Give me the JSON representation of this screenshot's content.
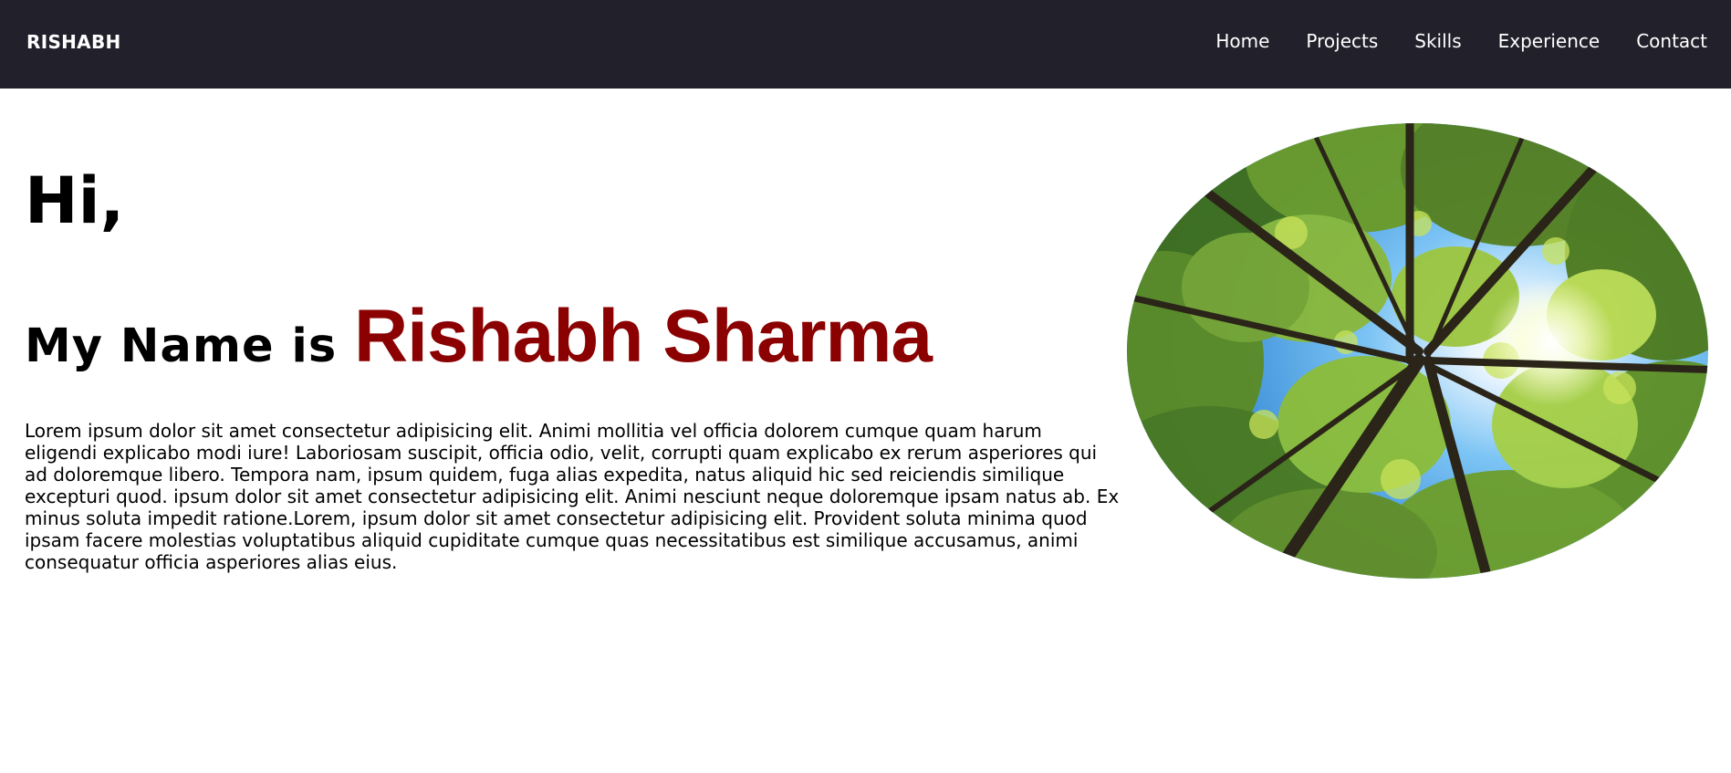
{
  "nav": {
    "brand": "RISHABH",
    "links": [
      "Home",
      "Projects",
      "Skills",
      "Experience",
      "Contact"
    ]
  },
  "hero": {
    "greeting": "Hi,",
    "intro_prefix": "My Name is ",
    "intro_name": "Rishabh Sharma",
    "bio": "Lorem ipsum dolor sit amet consectetur adipisicing elit. Animi mollitia vel officia dolorem cumque quam harum eligendi explicabo modi iure! Laboriosam suscipit, officia odio, velit, corrupti quam explicabo ex rerum asperiores qui ad doloremque libero. Tempora nam, ipsum quidem, fuga alias expedita, natus aliquid hic sed reiciendis similique excepturi quod. ipsum dolor sit amet consectetur adipisicing elit. Animi nesciunt neque doloremque ipsam natus ab. Ex minus soluta impedit ratione.Lorem, ipsum dolor sit amet consectetur adipisicing elit. Provident soluta minima quod ipsam facere molestias voluptatibus aliquid cupiditate cumque quas necessitatibus est similique accusamus, animi consequatur officia asperiores alias eius."
  },
  "colors": {
    "navbar_bg": "#22212b",
    "name_accent": "#8b0000"
  }
}
